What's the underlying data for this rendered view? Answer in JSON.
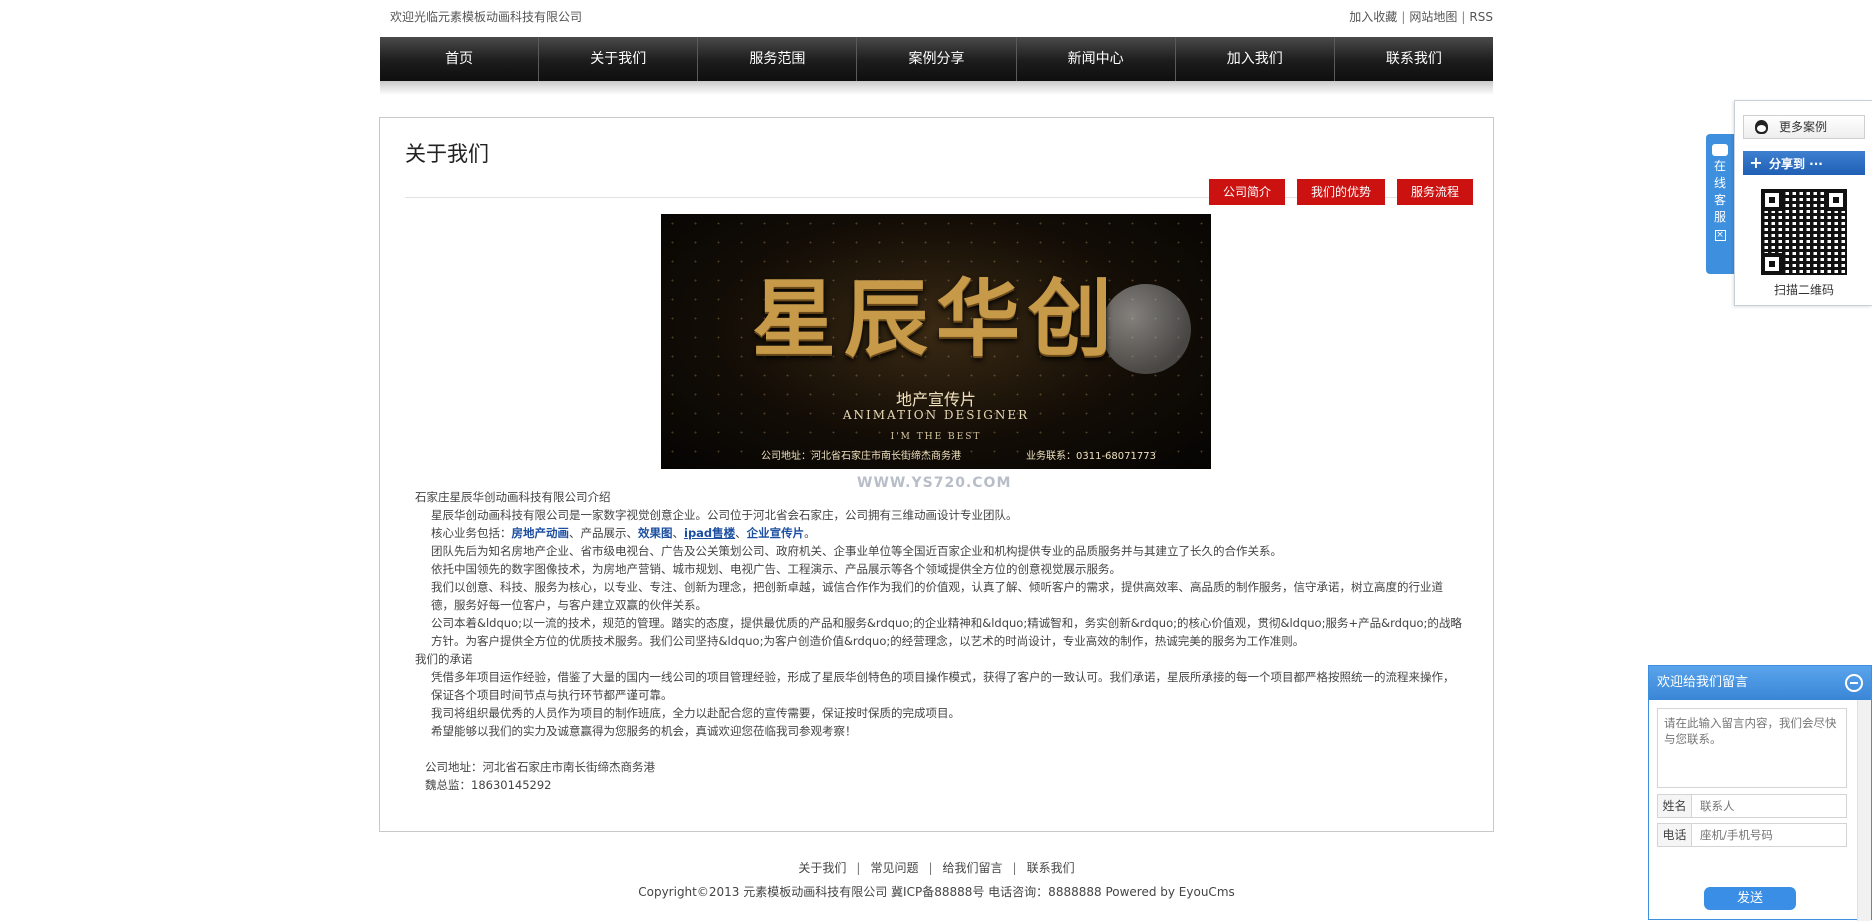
{
  "topbar": {
    "welcome": "欢迎光临元素模板动画科技有限公司",
    "links": [
      "加入收藏",
      "网站地图",
      "RSS"
    ]
  },
  "nav": {
    "items": [
      "首页",
      "关于我们",
      "服务范围",
      "案例分享",
      "新闻中心",
      "加入我们",
      "联系我们"
    ]
  },
  "page": {
    "title": "关于我们",
    "tabs": [
      "公司简介",
      "我们的优势",
      "服务流程"
    ]
  },
  "banner": {
    "headline": "星辰华创",
    "subtitle": "地产宣传片",
    "subtitle_en": "ANIMATION DESIGNER",
    "tagline": "I'M THE BEST",
    "address": "公司地址：河北省石家庄市南长街缔杰商务港",
    "phone": "业务联系：0311-68071773",
    "watermark": "WWW.YS720.COM"
  },
  "article": {
    "heading": "石家庄星辰华创动画科技有限公司介绍",
    "p1": "星辰华创动画科技有限公司是一家数字视觉创意企业。公司位于河北省会石家庄，公司拥有三维动画设计专业团队。",
    "p2_prefix": "核心业务包括：",
    "p2_items": [
      "房地产动画",
      "产品展示",
      "效果图",
      "ipad售楼",
      "企业宣传片"
    ],
    "p2_sep1": "、",
    "p2_end": "。",
    "p3": "团队先后为知名房地产企业、省市级电视台、广告及公关策划公司、政府机关、企事业单位等全国近百家企业和机构提供专业的品质服务并与其建立了长久的合作关系。",
    "p4": "依托中国领先的数字图像技术，为房地产营销、城市规划、电视广告、工程演示、产品展示等各个领域提供全方位的创意视觉展示服务。",
    "p5": "我们以创意、科技、服务为核心，以专业、专注、创新为理念，把创新卓越，诚信合作作为我们的价值观，认真了解、倾听客户的需求，提供高效率、高品质的制作服务，信守承诺，树立高度的行业道德，服务好每一位客户，与客户建立双赢的伙伴关系。",
    "p6": "公司本着&ldquo;以一流的技术，规范的管理。踏实的态度，提供最优质的产品和服务&rdquo;的企业精神和&ldquo;精诚智和，务实创新&rdquo;的核心价值观，贯彻&ldquo;服务+产品&rdquo;的战略方针。为客户提供全方位的优质技术服务。我们公司坚持&ldquo;为客户创造价值&rdquo;的经营理念，以艺术的时尚设计，专业高效的制作，热诚完美的服务为工作准则。",
    "heading2": "我们的承诺",
    "p7": "凭借多年项目运作经验，借鉴了大量的国内一线公司的项目管理经验，形成了星辰华创特色的项目操作模式，获得了客户的一致认可。我们承诺，星辰所承接的每一个项目都严格按照统一的流程来操作，保证各个项目时间节点与执行环节都严谨可靠。",
    "p8": "我司将组织最优秀的人员作为项目的制作班底，全力以赴配合您的宣传需要，保证按时保质的完成项目。",
    "p9": "希望能够以我们的实力及诚意赢得为您服务的机会，真诚欢迎您莅临我司参观考察！",
    "addr": "公司地址：河北省石家庄市南长街缔杰商务港",
    "contact": "魏总监：18630145292"
  },
  "footer": {
    "links": [
      "关于我们",
      "常见问题",
      "给我们留言",
      "联系我们"
    ],
    "copyright": "Copyright©2013 元素模板动画科技有限公司 冀ICP备88888号 电话咨询：8888888 Powered by EyouCms"
  },
  "side_tab": {
    "chars": [
      "在",
      "线",
      "客",
      "服"
    ],
    "close": "×"
  },
  "share": {
    "more_label": "更多案例",
    "share_label": "分享到 ···",
    "plus": "+",
    "scan_label": "扫描二维码"
  },
  "message": {
    "title": "欢迎给我们留言",
    "textarea_placeholder": "请在此输入留言内容，我们会尽快与您联系。",
    "name_label": "姓名",
    "name_placeholder": "联系人",
    "phone_label": "电话",
    "phone_placeholder": "座机/手机号码",
    "send_label": "发送"
  },
  "colors": {
    "accent_red": "#cc1111",
    "nav_dark": "#1c1c1c",
    "link_blue": "#1d4fa1",
    "panel_blue": "#3e8fdd"
  }
}
